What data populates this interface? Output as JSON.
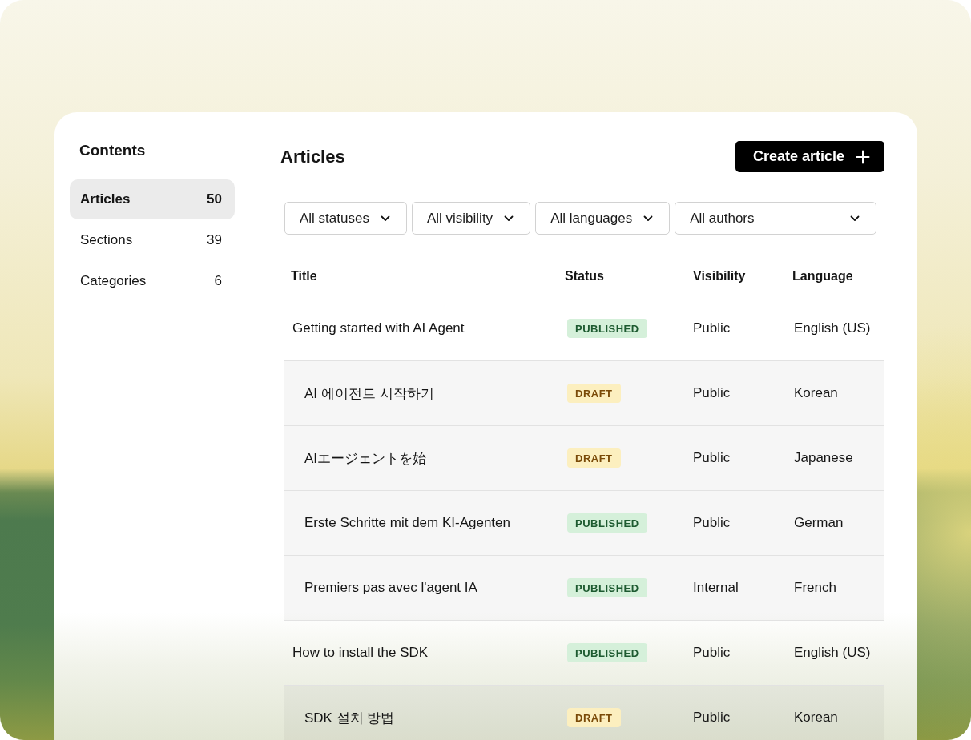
{
  "sidebar": {
    "title": "Contents",
    "items": [
      {
        "label": "Articles",
        "count": "50",
        "selected": true
      },
      {
        "label": "Sections",
        "count": "39",
        "selected": false
      },
      {
        "label": "Categories",
        "count": "6",
        "selected": false
      }
    ]
  },
  "header": {
    "title": "Articles",
    "create_button": "Create article"
  },
  "filters": [
    {
      "label": "All statuses"
    },
    {
      "label": "All visibility"
    },
    {
      "label": "All languages"
    },
    {
      "label": "All authors"
    }
  ],
  "table": {
    "columns": [
      "Title",
      "Status",
      "Visibility",
      "Language"
    ],
    "rows": [
      {
        "title": "Getting started with AI Agent",
        "status": {
          "label": "PUBLISHED",
          "kind": "published"
        },
        "visibility": "Public",
        "language": "English (US)",
        "children": [
          {
            "title": "AI 에이전트 시작하기",
            "status": {
              "label": "DRAFT",
              "kind": "draft"
            },
            "visibility": "Public",
            "language": "Korean"
          },
          {
            "title": "AIエージェントを始",
            "status": {
              "label": "DRAFT",
              "kind": "draft"
            },
            "visibility": "Public",
            "language": "Japanese"
          },
          {
            "title": "Erste Schritte mit dem KI-Agenten",
            "status": {
              "label": "PUBLISHED",
              "kind": "published"
            },
            "visibility": "Public",
            "language": "German"
          },
          {
            "title": "Premiers pas avec l'agent IA",
            "status": {
              "label": "PUBLISHED",
              "kind": "published"
            },
            "visibility": "Internal",
            "language": "French"
          }
        ]
      },
      {
        "title": "How to install the SDK",
        "status": {
          "label": "PUBLISHED",
          "kind": "published"
        },
        "visibility": "Public",
        "language": "English (US)",
        "children": [
          {
            "title": "SDK 설치 방법",
            "status": {
              "label": "DRAFT",
              "kind": "draft"
            },
            "visibility": "Public",
            "language": "Korean"
          }
        ]
      }
    ]
  }
}
